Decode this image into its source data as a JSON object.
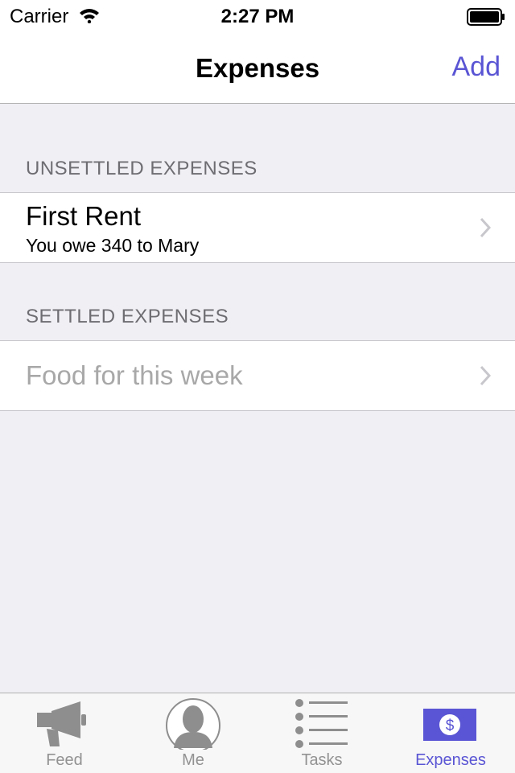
{
  "status_bar": {
    "carrier": "Carrier",
    "time": "2:27 PM"
  },
  "nav": {
    "title": "Expenses",
    "add_label": "Add"
  },
  "sections": {
    "unsettled": {
      "header": "UNSETTLED EXPENSES",
      "items": [
        {
          "title": "First Rent",
          "subtitle": "You owe 340 to Mary"
        }
      ]
    },
    "settled": {
      "header": "SETTLED EXPENSES",
      "items": [
        {
          "title": "Food for this week"
        }
      ]
    }
  },
  "tabs": [
    {
      "label": "Feed",
      "icon": "megaphone-icon",
      "active": false
    },
    {
      "label": "Me",
      "icon": "person-icon",
      "active": false
    },
    {
      "label": "Tasks",
      "icon": "list-icon",
      "active": false
    },
    {
      "label": "Expenses",
      "icon": "dollar-bill-icon",
      "active": true
    }
  ],
  "colors": {
    "accent": "#5a55d4",
    "background": "#efeff4",
    "inactive_tab": "#929292",
    "settled_text": "#a8a8a8"
  }
}
